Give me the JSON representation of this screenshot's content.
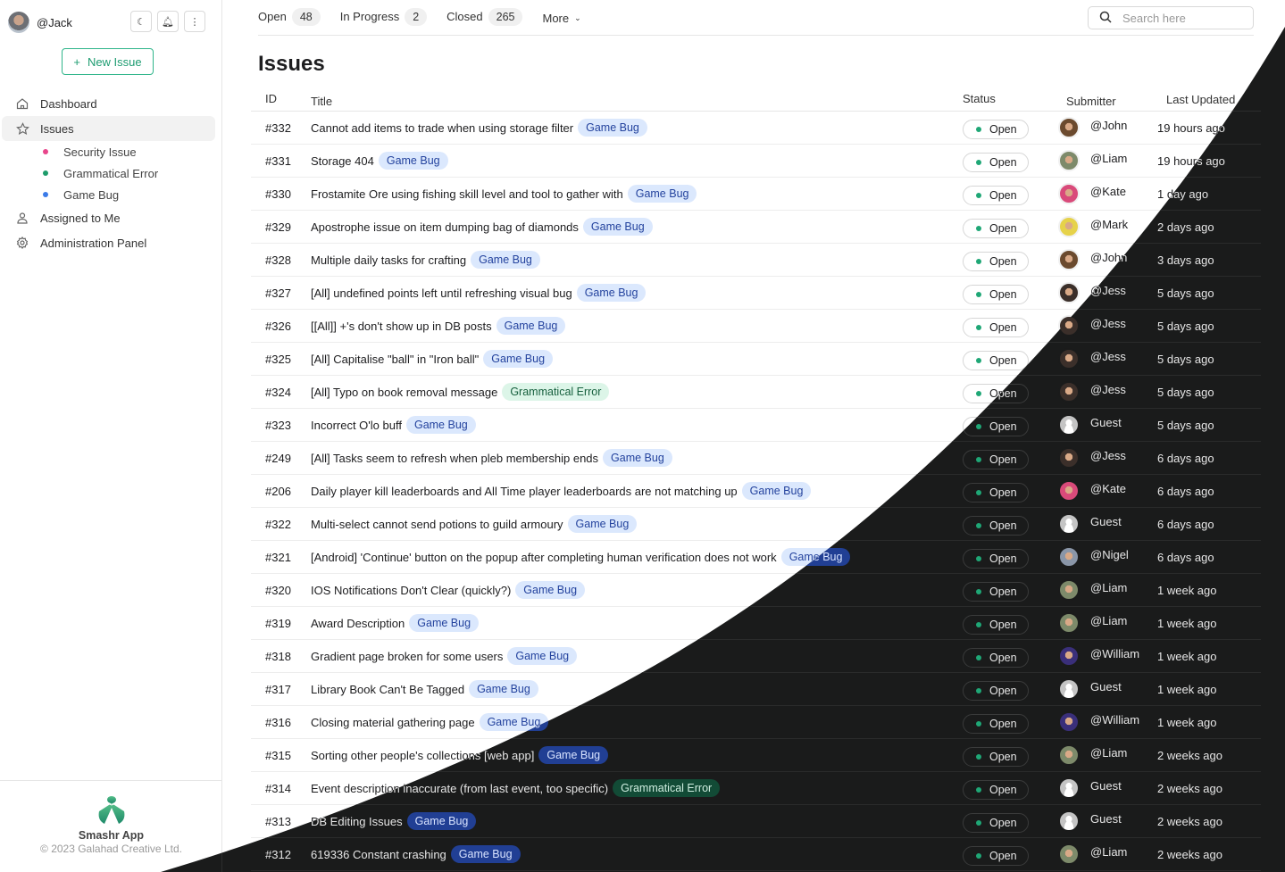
{
  "user": {
    "name": "@Jack"
  },
  "sidebar": {
    "new_issue": "New Issue",
    "items": [
      {
        "label": "Dashboard",
        "icon": "home-icon"
      },
      {
        "label": "Issues",
        "icon": "star-icon",
        "active": true
      },
      {
        "label": "Assigned to Me",
        "icon": "user-icon"
      },
      {
        "label": "Administration Panel",
        "icon": "gear-icon"
      }
    ],
    "sub_items": [
      {
        "label": "Security Issue",
        "color": "#e8458b"
      },
      {
        "label": "Grammatical Error",
        "color": "#1e9c6b"
      },
      {
        "label": "Game Bug",
        "color": "#3b7be8"
      }
    ],
    "footer": {
      "app_name": "Smashr App",
      "copyright": "© 2023 Galahad Creative Ltd."
    }
  },
  "tabs": [
    {
      "label": "Open",
      "count": "48"
    },
    {
      "label": "In Progress",
      "count": "2"
    },
    {
      "label": "Closed",
      "count": "265"
    },
    {
      "label": "More"
    }
  ],
  "search": {
    "placeholder": "Search here"
  },
  "page_title": "Issues",
  "table": {
    "columns": [
      "ID",
      "Title",
      "Status",
      "Submitter",
      "Last Updated"
    ],
    "rows": [
      {
        "id": "#332",
        "title": "Cannot add items to trade when using storage filter",
        "tag": "Game Bug",
        "status": "Open",
        "submitter": "@John",
        "updated": "19 hours ago"
      },
      {
        "id": "#331",
        "title": "Storage 404",
        "tag": "Game Bug",
        "status": "Open",
        "submitter": "@Liam",
        "updated": "19 hours ago"
      },
      {
        "id": "#330",
        "title": "Frostamite Ore using fishing skill level and tool to gather with",
        "tag": "Game Bug",
        "status": "Open",
        "submitter": "@Kate",
        "updated": "1 day ago"
      },
      {
        "id": "#329",
        "title": "Apostrophe issue on item dumping bag of diamonds",
        "tag": "Game Bug",
        "status": "Open",
        "submitter": "@Mark",
        "updated": "2 days ago"
      },
      {
        "id": "#328",
        "title": "Multiple daily tasks for crafting",
        "tag": "Game Bug",
        "status": "Open",
        "submitter": "@John",
        "updated": "3 days ago"
      },
      {
        "id": "#327",
        "title": "[All] undefined points left until refreshing visual bug",
        "tag": "Game Bug",
        "status": "Open",
        "submitter": "@Jess",
        "updated": "5 days ago"
      },
      {
        "id": "#326",
        "title": "[[All]] +'s don't show up in DB posts",
        "tag": "Game Bug",
        "status": "Open",
        "submitter": "@Jess",
        "updated": "5 days ago"
      },
      {
        "id": "#325",
        "title": "[All] Capitalise \"ball\" in \"Iron ball\"",
        "tag": "Game Bug",
        "status": "Open",
        "submitter": "@Jess",
        "updated": "5 days ago"
      },
      {
        "id": "#324",
        "title": "[All] Typo on book removal message",
        "tag": "Grammatical Error",
        "status": "Open",
        "submitter": "@Jess",
        "updated": "5 days ago"
      },
      {
        "id": "#323",
        "title": "Incorrect O'lo buff",
        "tag": "Game Bug",
        "status": "Open",
        "submitter": "Guest",
        "updated": "5 days ago"
      },
      {
        "id": "#249",
        "title": "[All] Tasks seem to refresh when pleb membership ends",
        "tag": "Game Bug",
        "status": "Open",
        "submitter": "@Jess",
        "updated": "6 days ago"
      },
      {
        "id": "#206",
        "title": "Daily player kill leaderboards and All Time player leaderboards are not matching up",
        "tag": "Game Bug",
        "status": "Open",
        "submitter": "@Kate",
        "updated": "6 days ago"
      },
      {
        "id": "#322",
        "title": "Multi-select cannot send potions to guild armoury",
        "tag": "Game Bug",
        "status": "Open",
        "submitter": "Guest",
        "updated": "6 days ago"
      },
      {
        "id": "#321",
        "title": "[Android] 'Continue' button on the popup after completing human verification does not work",
        "tag": "Game Bug",
        "status": "Open",
        "submitter": "@Nigel",
        "updated": "6 days ago"
      },
      {
        "id": "#320",
        "title": "IOS Notifications Don't Clear (quickly?)",
        "tag": "Game Bug",
        "status": "Open",
        "submitter": "@Liam",
        "updated": "1 week ago"
      },
      {
        "id": "#319",
        "title": "Award Description",
        "tag": "Game Bug",
        "status": "Open",
        "submitter": "@Liam",
        "updated": "1 week ago"
      },
      {
        "id": "#318",
        "title": "Gradient page broken for some users",
        "tag": "Game Bug",
        "status": "Open",
        "submitter": "@William",
        "updated": "1 week ago"
      },
      {
        "id": "#317",
        "title": "Library Book Can't Be Tagged",
        "tag": "Game Bug",
        "status": "Open",
        "submitter": "Guest",
        "updated": "1 week ago"
      },
      {
        "id": "#316",
        "title": "Closing material gathering page",
        "tag": "Game Bug",
        "status": "Open",
        "submitter": "@William",
        "updated": "1 week ago"
      },
      {
        "id": "#315",
        "title": "Sorting other people's collections [web app]",
        "tag": "Game Bug",
        "status": "Open",
        "submitter": "@Liam",
        "updated": "2 weeks ago"
      },
      {
        "id": "#314",
        "title": "Event description inaccurate (from last event, too specific)",
        "tag": "Grammatical Error",
        "status": "Open",
        "submitter": "Guest",
        "updated": "2 weeks ago"
      },
      {
        "id": "#313",
        "title": "DB Editing Issues",
        "tag": "Game Bug",
        "status": "Open",
        "submitter": "Guest",
        "updated": "2 weeks ago"
      },
      {
        "id": "#312",
        "title": "619336 Constant crashing",
        "tag": "Game Bug",
        "status": "Open",
        "submitter": "@Liam",
        "updated": "2 weeks ago"
      }
    ]
  },
  "avatar_colors": {
    "@John": "#6b4a2e",
    "@Liam": "#7d8a6a",
    "@Kate": "#d94a7a",
    "@Mark": "#e6d24a",
    "@Jess": "#3b2f2a",
    "Guest": "#c4c4c4",
    "@Nigel": "#8a96a8",
    "@William": "#3a2f7a",
    "@Jack": "#8a8f96"
  }
}
